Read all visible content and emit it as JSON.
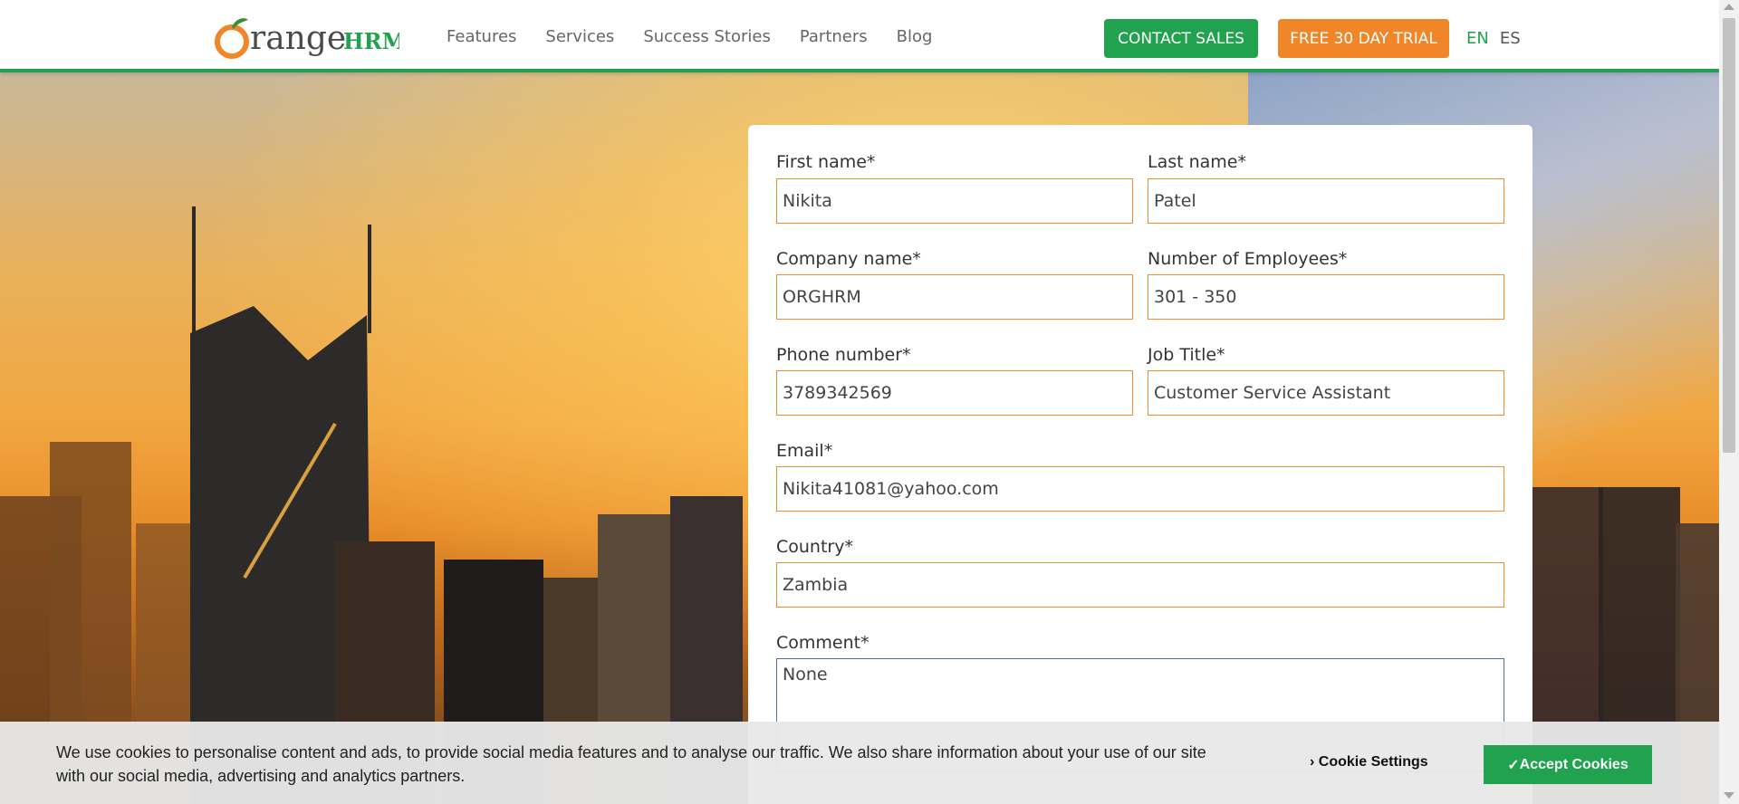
{
  "header": {
    "logo_alt": "OrangeHRM",
    "nav": [
      "Features",
      "Services",
      "Success Stories",
      "Partners",
      "Blog"
    ],
    "contact_sales": "CONTACT SALES",
    "free_trial": "FREE 30 DAY TRIAL",
    "lang_en": "EN",
    "lang_es": "ES"
  },
  "form": {
    "first_name_label": "First name*",
    "first_name_value": "Nikita",
    "last_name_label": "Last name*",
    "last_name_value": "Patel",
    "company_label": "Company name*",
    "company_value": "ORGHRM",
    "employees_label": "Number of Employees*",
    "employees_value": "301 - 350",
    "phone_label": "Phone number*",
    "phone_value": "3789342569",
    "job_label": "Job Title*",
    "job_value": "Customer Service Assistant",
    "email_label": "Email*",
    "email_value": "Nikita41081@yahoo.com",
    "country_label": "Country*",
    "country_value": "Zambia",
    "comment_label": "Comment*",
    "comment_value": "None"
  },
  "cookie": {
    "text": "We use cookies to personalise content and ads, to provide social media features and to analyse our traffic. We also share information about your use of our site with our social media, advertising and analytics partners.",
    "settings": "Cookie Settings",
    "accept": "Accept Cookies"
  },
  "colors": {
    "brand_green": "#20a24f",
    "brand_orange": "#f08628",
    "field_border": "#f08a2a"
  }
}
